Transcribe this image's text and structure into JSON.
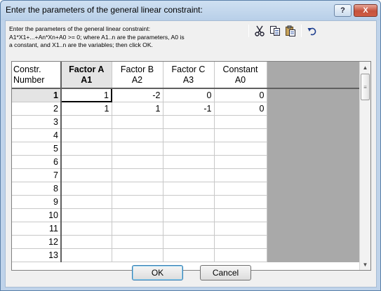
{
  "window": {
    "title": "Enter the parameters of the general linear constraint:",
    "help_label": "?",
    "close_label": "X"
  },
  "instructions": [
    "Enter the parameters of the general linear constraint:",
    "A1*X1+...+An*Xn+A0 >= 0; where A1..n are the parameters, A0 is",
    "a constant, and X1..n are the variables; then click OK."
  ],
  "toolbar": {
    "icons": [
      "cut-icon",
      "copy-icon",
      "paste-icon",
      "undo-icon"
    ]
  },
  "grid": {
    "row_header_label": [
      "Constr.",
      "Number"
    ],
    "columns": [
      {
        "line1": "Factor A",
        "line2": "A1"
      },
      {
        "line1": "Factor B",
        "line2": "A2"
      },
      {
        "line1": "Factor C",
        "line2": "A3"
      },
      {
        "line1": "Constant",
        "line2": "A0"
      }
    ],
    "rows": [
      {
        "num": "1",
        "cells": [
          "1",
          "-2",
          "0",
          "0"
        ]
      },
      {
        "num": "2",
        "cells": [
          "1",
          "1",
          "-1",
          "0"
        ]
      },
      {
        "num": "3",
        "cells": [
          "",
          "",
          "",
          ""
        ]
      },
      {
        "num": "4",
        "cells": [
          "",
          "",
          "",
          ""
        ]
      },
      {
        "num": "5",
        "cells": [
          "",
          "",
          "",
          ""
        ]
      },
      {
        "num": "6",
        "cells": [
          "",
          "",
          "",
          ""
        ]
      },
      {
        "num": "7",
        "cells": [
          "",
          "",
          "",
          ""
        ]
      },
      {
        "num": "8",
        "cells": [
          "",
          "",
          "",
          ""
        ]
      },
      {
        "num": "9",
        "cells": [
          "",
          "",
          "",
          ""
        ]
      },
      {
        "num": "10",
        "cells": [
          "",
          "",
          "",
          ""
        ]
      },
      {
        "num": "11",
        "cells": [
          "",
          "",
          "",
          ""
        ]
      },
      {
        "num": "12",
        "cells": [
          "",
          "",
          "",
          ""
        ]
      },
      {
        "num": "13",
        "cells": [
          "",
          "",
          "",
          ""
        ]
      }
    ],
    "active_row": "1",
    "active_column": "Factor A"
  },
  "buttons": {
    "ok_label": "OK",
    "cancel_label": "Cancel"
  }
}
